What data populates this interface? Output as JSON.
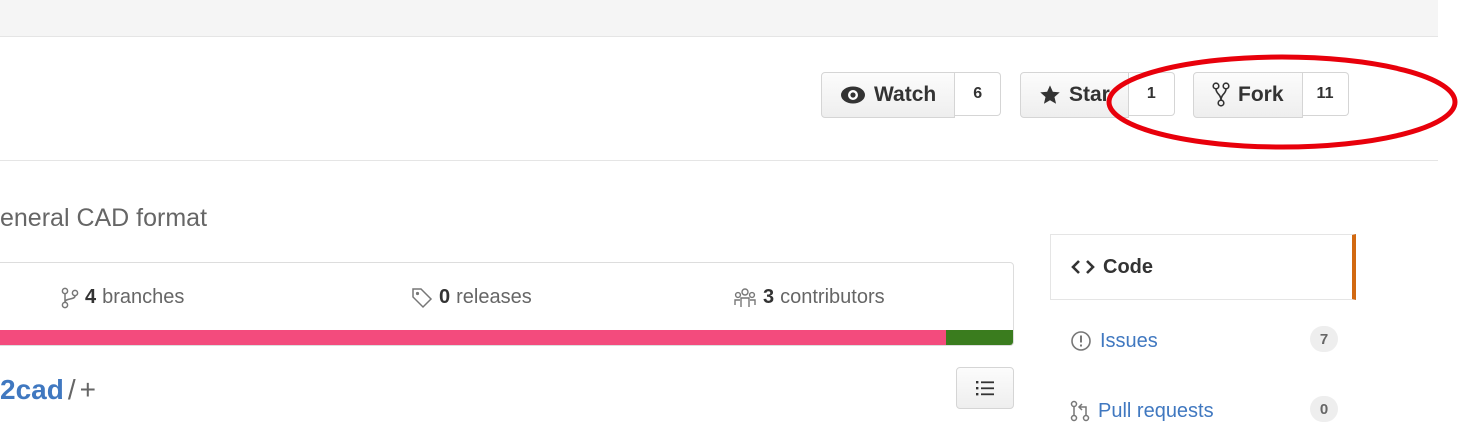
{
  "header": {
    "watch": {
      "label": "Watch",
      "count": "6",
      "icon": "eye-icon"
    },
    "star": {
      "label": "Star",
      "count": "1",
      "icon": "star-icon"
    },
    "fork": {
      "label": "Fork",
      "count": "11",
      "icon": "repo-forked-icon"
    }
  },
  "repo": {
    "description": "eneral CAD format",
    "summary": [
      {
        "count": "4",
        "label": "branches",
        "icon": "git-branch-icon"
      },
      {
        "count": "0",
        "label": "releases",
        "icon": "tag-icon"
      },
      {
        "count": "3",
        "label": "contributors",
        "icon": "organization-icon"
      }
    ],
    "language_bar": {
      "colors": [
        "#f34b7d",
        "#3a7c1e"
      ]
    },
    "path": {
      "repo": "2cad",
      "separator": "/",
      "add": "+"
    }
  },
  "sidebar": {
    "items": [
      {
        "label": "Code",
        "icon": "code-icon",
        "selected": true
      },
      {
        "label": "Issues",
        "icon": "issue-opened-icon",
        "count": "7"
      },
      {
        "label": "Pull requests",
        "icon": "git-pull-request-icon",
        "count": "0"
      }
    ]
  },
  "annotation": {
    "color": "#e8000b",
    "shape": "ellipse"
  }
}
